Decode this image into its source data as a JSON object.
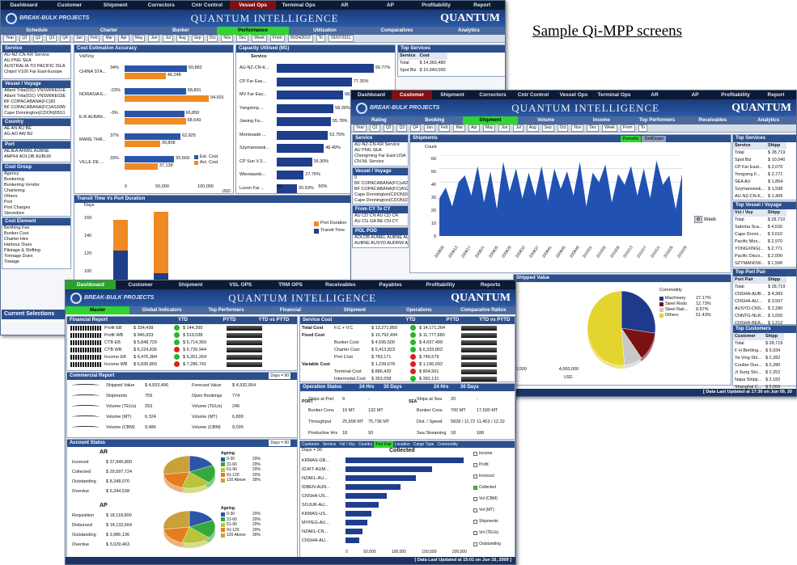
{
  "caption": "Sample Qi-MPP screens",
  "brand": {
    "logo": "BREAK-BULK PROJECTS",
    "product": "QUANTUM INTELLIGENCE",
    "company": "QUANTUM",
    "tag": "Business Solutions & Outsourcing"
  },
  "w1": {
    "topnav": [
      "Dashboard",
      "Customer",
      "Shipment",
      "Correctors",
      "Cntr Control",
      "Vessel Ops",
      "Terminal Ops",
      "AR",
      "AP",
      "Profitability",
      "Report"
    ],
    "subnav": [
      "Schedule",
      "Charter",
      "Bunker",
      "Performance",
      "Utilization",
      "Comparatives",
      "Analytics"
    ],
    "timebar": [
      "Year",
      "Q1",
      "Q2",
      "Q3",
      "Q4",
      "Jan",
      "Feb",
      "Mar",
      "Apr",
      "May",
      "Jun",
      "Jul",
      "Aug",
      "Sep",
      "Oct",
      "Nov",
      "Dec",
      "Week",
      "From",
      "05/04/2010",
      "To",
      "03/07/2011"
    ],
    "service": {
      "title": "Service",
      "items": [
        "AU-NZ-CN-KR Service",
        "AU PNG SEA",
        "AUSTRALIA TO PACIFIC ISLA",
        "Chipol V100 Far East-Europe"
      ]
    },
    "vessel": {
      "title": "Vessel / Voyage",
      "items": [
        "Atlant Trita(031) VNSWIRE01E",
        "Atlant Trita(031) VNSWIRE03E",
        "BF COPACABANA(FC)82",
        "BF COPACABANA(FC)AS30W",
        "Cape Donnington(CDON)05S1"
      ]
    },
    "country": {
      "title": "Country",
      "items": [
        "AE  AN  AU  BE",
        "AG  AO  AW  BZ"
      ]
    },
    "port": {
      "title": "Port",
      "items": [
        "AEJEA  ANWIL  AUBNE",
        "AMPHI  AOLOB  AUBUR"
      ]
    },
    "costgroup": {
      "title": "Cost Group",
      "items": [
        "Agency",
        "Bunkering",
        "Bunkering Vendor",
        "Chartering",
        "Others",
        "Port",
        "Port Charges",
        "Stevedore"
      ]
    },
    "costelement": {
      "title": "Cost Element",
      "items": [
        "Berthing Fee",
        "Bunker Cost",
        "Charter Hire",
        "Harbour Dues",
        "Pilotage & Shifting",
        "Tonnage Dues",
        "Towage"
      ]
    },
    "current": "Current Selections",
    "est_title": "Cost Estimation Accuracy",
    "est_vvoy": "Vsl/Voy",
    "est_unit": "USD",
    "est_legend": [
      "Est. Cost",
      "Act. Cost"
    ],
    "est_axis": [
      "0",
      "50,000",
      "100,000"
    ],
    "est_rows": [
      {
        "name": "CHINA STA...",
        "pct": "34%",
        "est": 69882,
        "est_t": "69,882",
        "act": 46248,
        "act_t": "46,248"
      },
      {
        "name": "NORASIA E...",
        "pct": "-23%",
        "est": 68891,
        "est_t": "68,891",
        "act": 94691,
        "act_t": "94,691"
      },
      {
        "name": "E.R.ALBAN...",
        "pct": "-3%",
        "est": 66850,
        "est_t": "66,850",
        "act": 68643,
        "act_t": "68,643"
      },
      {
        "name": "MARE THR...",
        "pct": "37%",
        "est": 62825,
        "est_t": "62,825",
        "act": 39808,
        "act_t": "39,808"
      },
      {
        "name": "VILLE DE ...",
        "pct": "33%",
        "est": 55669,
        "est_t": "55,669",
        "act": 37138,
        "act_t": "37,138"
      }
    ],
    "cap_title": "Capacity Utilised (M1)",
    "cap_sub": "Service",
    "cap_axis": [
      "0%",
      "50%",
      "100%"
    ],
    "cap_rows": [
      {
        "name": "AU-NZ-CN-K...",
        "v": 99.77,
        "t": "99.77%"
      },
      {
        "name": "CP Far Eas...",
        "v": 77.35,
        "t": "77.35%"
      },
      {
        "name": "MV Far Eas...",
        "v": 68.29,
        "t": "68.29%"
      },
      {
        "name": "Yangxiing ...",
        "v": 58.39,
        "t": "58.39%"
      },
      {
        "name": "Jiaxing Fa...",
        "v": 55.78,
        "t": "55.78%"
      },
      {
        "name": "Monissade ...",
        "v": 52.75,
        "t": "52.75%"
      },
      {
        "name": "Szymanowsk...",
        "v": 48.49,
        "t": "48.49%"
      },
      {
        "name": "CP Sun V.3...",
        "v": 36.3,
        "t": "36.30%"
      },
      {
        "name": "Wieniawski...",
        "v": 27.76,
        "t": "27.76%"
      },
      {
        "name": "Luxon Far ...",
        "v": 20.93,
        "t": "20.93%"
      }
    ],
    "top_title": "Top Services",
    "top_head": [
      "Service",
      "Cost"
    ],
    "top_rows": [
      [
        "Total",
        "$ 14,365,480"
      ],
      [
        "Spot Biz",
        "$ 10,040,000"
      ]
    ],
    "transit_title": "Transit Time Vs Port Duration",
    "transit_y": "Days",
    "transit_ticks": [
      "160",
      "140",
      "120",
      "100"
    ],
    "transit_legend": [
      "Port Duration",
      "Transit Time"
    ]
  },
  "w2": {
    "topnav": [
      "Dashboard",
      "Customer",
      "Shipment",
      "Correctors",
      "Cntr Control",
      "Vessel Ops",
      "Terminal Ops",
      "AR",
      "AP",
      "Profitability",
      "Report"
    ],
    "subnav": [
      "Rating",
      "Booking",
      "Shipment",
      "Volume",
      "Income",
      "Top Performers",
      "Receivables",
      "Analytics"
    ],
    "timebar": [
      "Year",
      "Q1",
      "Q2",
      "Q3",
      "Q4",
      "Jan",
      "Feb",
      "Mar",
      "Apr",
      "May",
      "Jun",
      "Jul",
      "Aug",
      "Sep",
      "Oct",
      "Nov",
      "Dec",
      "Week",
      "From",
      "To"
    ],
    "service": {
      "title": "Service",
      "items": [
        "AU-NZ-CN-KR Service",
        "AU PNG SEA",
        "Chongming Far East-USA",
        "CN-NL Service"
      ]
    },
    "vessel": {
      "title": "Vessel / Voyage",
      "items": [
        "0",
        "BF COPACABANA(FC)s82",
        "BF COPACABANA(FC)AS30W",
        "Cape Donnington(CDON)05S1",
        "Cape Donnington(CDON)200n"
      ]
    },
    "from": {
      "title": "From CY  To CY",
      "items": [
        "AU  CD  CN  AU  CD  CR",
        "AU  CG  GA  BE  CN  CY"
      ]
    },
    "pol": {
      "title": "POL  POD",
      "items": [
        "AOLOB AUMEL AUBNE AUMEL",
        "AUBNE AUSYD AUDRW AUNTL"
      ]
    },
    "ship_title": "Shipments",
    "ship_tabs": [
      "Periodic",
      "DrillDown"
    ],
    "ship_y": "Count",
    "ship_ticks": [
      "60",
      "50",
      "40",
      "30",
      "20",
      "10",
      "0"
    ],
    "ship_week": "Week",
    "ship_dates": [
      "200809",
      "200813",
      "200817",
      "200821",
      "200825",
      "200829",
      "200833",
      "200837",
      "200841",
      "200845",
      "200849",
      "201001",
      "201005",
      "201009",
      "201013",
      "201017",
      "201021",
      "201025",
      "201029"
    ],
    "series": [
      28,
      36,
      22,
      40,
      45,
      30,
      52,
      25,
      48,
      20,
      55,
      33,
      50,
      28,
      47,
      30,
      52,
      26,
      50,
      35,
      48,
      30,
      55,
      22,
      47,
      40,
      53,
      25,
      46,
      38,
      52,
      30,
      50,
      28,
      56,
      38,
      45,
      20,
      46
    ],
    "value_title": "Shipped Value",
    "value_unit": "USD",
    "value_axis": [
      "0,000",
      "4,000,000"
    ],
    "commodity_title": "Commodity",
    "commodity": [
      {
        "name": "Machinery",
        "pct": "27.17%",
        "v": 27.17,
        "color": "#1f3a8c"
      },
      {
        "name": "Steel Rods",
        "pct": "12.73%",
        "v": 12.73,
        "color": "#7a1212"
      },
      {
        "name": "Steel Rail...",
        "pct": "8.67%",
        "v": 8.67,
        "color": "#c8c8c8"
      },
      {
        "name": "Others",
        "pct": "51.43%",
        "v": 51.43,
        "color": "#e3d430"
      }
    ],
    "topsvc_title": "Top Services",
    "topsvc_head": [
      "Service",
      "Shipp"
    ],
    "topsvc_rows": [
      [
        "Total",
        "$ 28,719"
      ],
      [
        "Spot Biz",
        "$ 10,040"
      ],
      [
        "CP Far East...",
        "$ 2,070"
      ],
      [
        "Yongxing F...",
        "$ 2,771"
      ],
      [
        "SEA AU",
        "$ 1,854"
      ],
      [
        "Szymanowsk...",
        "$ 1,598"
      ],
      [
        "AU-NZ-CN-K...",
        "$ 1,405"
      ],
      [
        "Jiaxing Far...",
        "$ 1,227"
      ]
    ],
    "topvv_title": "Top Vessel / Voyage",
    "topvv_head": [
      "Vsl / Voy",
      "Shipp"
    ],
    "topvv_rows": [
      [
        "Total",
        "$ 28,719"
      ],
      [
        "Sabrina Sca...",
        "$ 4,530"
      ],
      [
        "Cape Donni...",
        "$ 3,610"
      ],
      [
        "Pacific Mos...",
        "$ 2,970"
      ],
      [
        "YONGXING(...",
        "$ 2,771"
      ],
      [
        "Pacific Disco...",
        "$ 2,000"
      ],
      [
        "SZYMANOW...",
        "$ 1,598"
      ],
      [
        "LODESTAR ...",
        "$ 1,405"
      ]
    ],
    "toppp_title": "Top Port Pair",
    "toppp_head": [
      "Port Pair",
      "Shipp"
    ],
    "toppp_rows": [
      [
        "Total",
        "$ 28,719"
      ],
      [
        "CNSHA-AUB...",
        "$ 4,383"
      ],
      [
        "CNSHA-AU...",
        "$ 3,567"
      ],
      [
        "AUSYD-CNS...",
        "$ 2,280"
      ],
      [
        "CNNTG-NLR...",
        "$ 1,650"
      ],
      [
        "CNSHA-BEA...",
        "$ 1,212"
      ],
      [
        "KRMAS-US...",
        "$ 935"
      ],
      [
        "IDBEN-AUNTL",
        "$ 891"
      ]
    ],
    "topcust_title": "Top Customers",
    "topcust_head": [
      "Customer",
      "Shipp"
    ],
    "topcust_rows": [
      [
        "Total",
        "$ 28,719"
      ],
      [
        "F H Bertling...",
        "$ 3,934"
      ],
      [
        "Ya Ving Shi...",
        "$ 2,282"
      ],
      [
        "Coulter Duo...",
        "$ 2,280"
      ],
      [
        "Ji Sung Shi...",
        "$ 2,252"
      ],
      [
        "Napa Shipp...",
        "$ 2,182"
      ],
      [
        "Shanghai C...",
        "$ 2,006"
      ],
      [
        "Deugro Proj...",
        "$ 2,000"
      ]
    ],
    "footer": "[ Data Last Updated at 17:30 on Jun 09, 20"
  },
  "w3": {
    "topnav": [
      "Dashboard",
      "Customer",
      "Shipment",
      "VSL OPS",
      "TRM OPS",
      "Receivables",
      "Payables",
      "Profitability",
      "Reports"
    ],
    "subnav": [
      "Master",
      "Global Indicators",
      "Top Performers",
      "Financial",
      "Shipment",
      "Operations",
      "Comparative Ratios"
    ],
    "fin_title": "Financial Report",
    "fin_head": [
      "YTD",
      "PYTD",
      "YTD vs PYTD"
    ],
    "fin_rows": [
      {
        "name": "Profit EB",
        "ytd": "$ 334,438",
        "status": "green",
        "pytd": "$ 144,395"
      },
      {
        "name": "Profit WB",
        "ytd": "$ 946,833",
        "status": "green",
        "pytd": "$ 519,038"
      },
      {
        "name": "CTB EB",
        "ytd": "$ 5,848,729",
        "status": "green",
        "pytd": "$ 5,714,369"
      },
      {
        "name": "CTB WB",
        "ytd": "$ 6,224,836",
        "status": "red",
        "pytd": "$ 6,726,944"
      },
      {
        "name": "Income EB",
        "ytd": "$ 6,476,384",
        "status": "green",
        "pytd": "$ 6,351,264"
      },
      {
        "name": "Income WB",
        "ytd": "$ 6,836,859",
        "status": "red",
        "pytd": "$ 7,286,741"
      }
    ],
    "svc_title": "Service Cost",
    "svc_head": [
      "YTD",
      "PYTD",
      "YTD vs PYTD"
    ],
    "svc_rows": [
      {
        "g": "Total Cost",
        "n": "F.C + V.C",
        "ytd": "$ 13,271,850",
        "s": "green",
        "pytd": "$ 14,171,264"
      },
      {
        "g": "Fixed Cost",
        "n": "",
        "ytd": "$ 10,792,494",
        "s": "green",
        "pytd": "$ 11,777,880"
      },
      {
        "g": "",
        "n": "Bunker Cost",
        "ytd": "$ 4,595,500",
        "s": "green",
        "pytd": "$ 4,697,499"
      },
      {
        "g": "",
        "n": "Charter Cost",
        "ytd": "$ 5,413,823",
        "s": "green",
        "pytd": "$ 6,333,802"
      },
      {
        "g": "",
        "n": "Port Cost",
        "ytd": "$ 783,171",
        "s": "red",
        "pytd": "$ 746,579"
      },
      {
        "g": "Variable Cost",
        "n": "",
        "ytd": "$ 1,239,678",
        "s": "red",
        "pytd": "$ 1,196,692"
      },
      {
        "g": "",
        "n": "Terminal Cost",
        "ytd": "$ 886,420",
        "s": "red",
        "pytd": "$ 804,561"
      },
      {
        "g": "",
        "n": "Intermodal Cost",
        "ytd": "$ 353,258",
        "s": "green",
        "pytd": "$ 392,131"
      }
    ],
    "com_title": "Commercial Report",
    "com_days": "Days = 90",
    "com_rows": [
      {
        "n": "Shipped Value",
        "v": "$ 4,553,496",
        "n2": "Forecast Value",
        "v2": "$ 4,932,954"
      },
      {
        "n": "Shipments",
        "v": "759",
        "n2": "Open Bookings",
        "v2": "774"
      },
      {
        "n": "Volume (TEUs)",
        "v": "253",
        "n2": "Volume (TEUs)",
        "v2": "245"
      },
      {
        "n": "Volume (MT)",
        "v": "6,324",
        "n2": "Volume (MT)",
        "v2": "6,899"
      },
      {
        "n": "Volume (CBM)",
        "v": "9,486",
        "n2": "Volume (CBM)",
        "v2": "9,035"
      }
    ],
    "ops_title": "Operation Status",
    "ops_tabs": [
      "24 Hrs",
      "30 Days",
      "24 Hrs",
      "30 Days"
    ],
    "ops_port": "PORT",
    "ops_sea": "SEA",
    "ops_left": [
      [
        "Ships at Port",
        "9",
        "-"
      ],
      [
        "Bunker Cons",
        "19 MT",
        "132 MT"
      ],
      [
        "Throughput",
        "25,658 MT",
        "75,736 MT"
      ],
      [
        "Productive Hrs",
        "18",
        "93"
      ]
    ],
    "ops_right": [
      [
        "Ships at Sea",
        "20",
        "-"
      ],
      [
        "Bunker Cons",
        "700 MT",
        "17,500 MT"
      ],
      [
        "Dist. / Speed",
        "5828 / 11.72",
        "11,453 / 12.32"
      ],
      [
        "Sea Streaming",
        "18",
        "186"
      ]
    ],
    "acct_title": "Account Status",
    "acct_days": "Days = 90",
    "ar": "AR",
    "ap": "AP",
    "ar_rows": [
      [
        "Invoiced",
        "$ 37,945,800"
      ],
      [
        "Collected",
        "$ 29,597,724"
      ],
      [
        "Outstanding",
        "$ 8,348,076"
      ],
      [
        "Overdue",
        "$ 6,344,538"
      ]
    ],
    "ap_rows": [
      [
        "Requisition",
        "$ 18,118,800"
      ],
      [
        "Disbursed",
        "$ 14,132,664"
      ],
      [
        "Outstanding",
        "$ 3,986,136"
      ],
      [
        "Overdue",
        "$ 3,029,463"
      ]
    ],
    "ageing_title": "Ageing",
    "ageing": [
      {
        "r": "0-30",
        "p": "20%",
        "c": "#2c55a8"
      },
      {
        "r": "31-60",
        "p": "20%",
        "c": "#36a83a"
      },
      {
        "r": "61-90",
        "p": "20%",
        "c": "#b9c43a"
      },
      {
        "r": "91-120",
        "p": "20%",
        "c": "#e57c20"
      },
      {
        "r": "120 Above",
        "p": "30%",
        "c": "#c9a03a"
      }
    ],
    "coll_tabs": [
      "Customer",
      "Service",
      "Vsl / Voy",
      "Country",
      "Port Pair",
      "Location",
      "Cargo Type",
      "Commodity"
    ],
    "coll_days": "Days = 90",
    "coll_title": "Collected",
    "coll_axis": [
      "0",
      "50,000",
      "100,000",
      "150,000",
      "200,000"
    ],
    "coll_rows": [
      {
        "n": "KRMAS-GB...",
        "v": 205000
      },
      {
        "n": "IDJKT-AUM...",
        "v": 150000
      },
      {
        "n": "NZAKL-AU...",
        "v": 122000
      },
      {
        "n": "IDBEN-AUN...",
        "v": 95000
      },
      {
        "n": "CNSHA-US...",
        "v": 72000
      },
      {
        "n": "SOJUR-AU...",
        "v": 58000
      },
      {
        "n": "KRMAS-US...",
        "v": 45000
      },
      {
        "n": "MYPEG-AU...",
        "v": 38000
      },
      {
        "n": "NZAKL-CN...",
        "v": 30000
      },
      {
        "n": "CNSHA-AU...",
        "v": 24000
      }
    ],
    "coll_checks": [
      "Income",
      "Profit",
      "Invoiced",
      "Collected",
      "Vol (CBM)",
      "Vol (MT)",
      "Shipments",
      "Vol (TEUs)",
      "Outstanding"
    ],
    "footer": "[ Data Last Updated at 15:01 on Jun 16, 2009 ]"
  }
}
